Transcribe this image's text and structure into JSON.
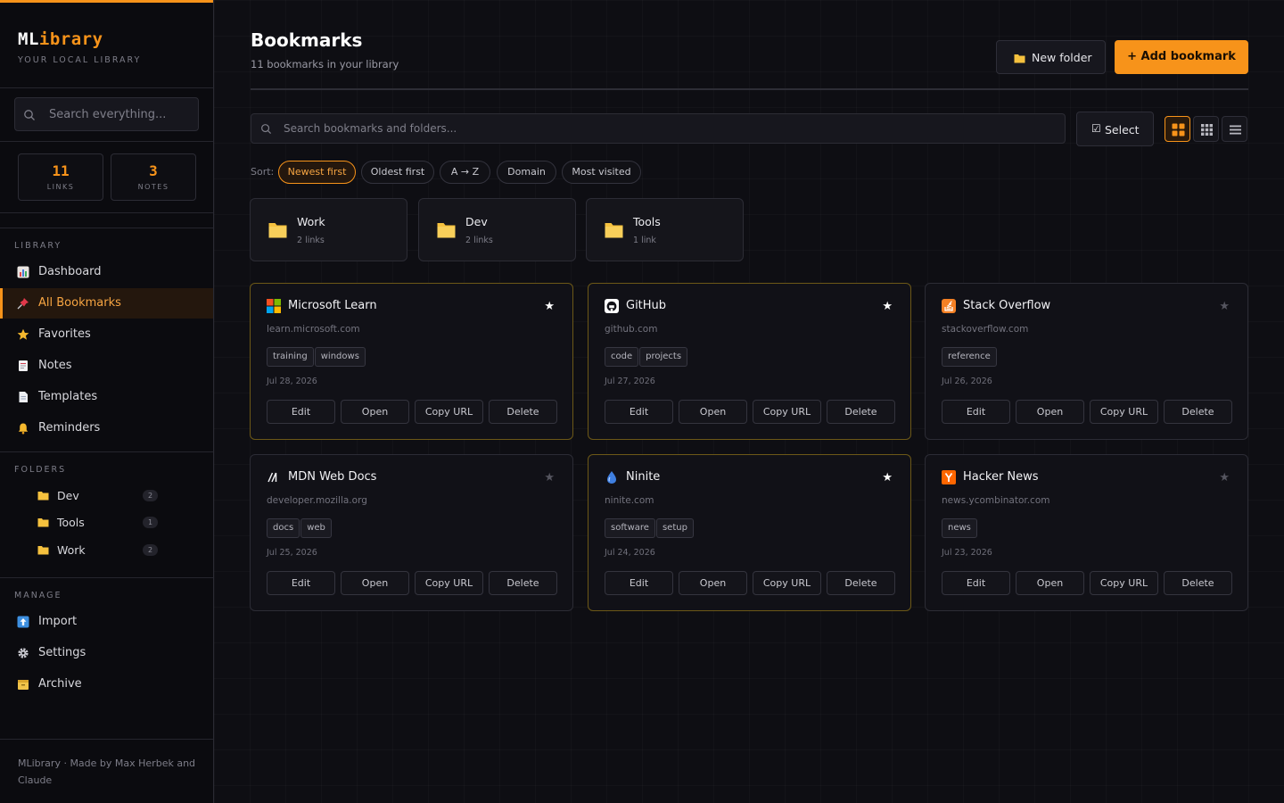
{
  "app": {
    "brand_part1": "ML",
    "brand_part2": "ibrary",
    "subtitle": "YOUR LOCAL LIBRARY",
    "accent": "#f7931a"
  },
  "sidebar": {
    "search_placeholder": "Search everything...",
    "stats": [
      {
        "value": "11",
        "label": "LINKS"
      },
      {
        "value": "3",
        "label": "NOTES"
      }
    ],
    "library_label": "LIBRARY",
    "library_items": [
      {
        "label": "Dashboard",
        "icon": "chart-icon",
        "active": false
      },
      {
        "label": "All Bookmarks",
        "icon": "pushpin-icon",
        "active": true
      },
      {
        "label": "Favorites",
        "icon": "star-icon",
        "active": false
      },
      {
        "label": "Notes",
        "icon": "note-icon",
        "active": false
      },
      {
        "label": "Templates",
        "icon": "document-icon",
        "active": false
      },
      {
        "label": "Reminders",
        "icon": "bell-icon",
        "active": false
      }
    ],
    "folders_label": "FOLDERS",
    "folders": [
      {
        "label": "Dev",
        "count": "2"
      },
      {
        "label": "Tools",
        "count": "1"
      },
      {
        "label": "Work",
        "count": "2"
      }
    ],
    "manage_label": "MANAGE",
    "manage_items": [
      {
        "label": "Import",
        "icon": "upload-icon"
      },
      {
        "label": "Settings",
        "icon": "gear-icon"
      },
      {
        "label": "Archive",
        "icon": "archive-icon"
      }
    ],
    "footer": "MLibrary · Made by Max Herbek and Claude"
  },
  "header": {
    "title": "Bookmarks",
    "subtitle": "11 bookmarks in your library",
    "new_folder_label": "New folder",
    "add_bookmark_label": "+ Add bookmark"
  },
  "toolbar": {
    "search_placeholder": "Search bookmarks and folders...",
    "select_check": "☑",
    "select_label": "Select",
    "view_modes": [
      "large-grid",
      "small-grid",
      "list"
    ],
    "active_view": "large-grid"
  },
  "sort": {
    "label": "Sort:",
    "options": [
      "Newest first",
      "Oldest first",
      "A → Z",
      "Domain",
      "Most visited"
    ],
    "active": "Newest first"
  },
  "folder_cards": [
    {
      "name": "Work",
      "count": "2 links"
    },
    {
      "name": "Dev",
      "count": "2 links"
    },
    {
      "name": "Tools",
      "count": "1 link"
    }
  ],
  "bookmarks": [
    {
      "title": "Microsoft Learn",
      "domain": "learn.microsoft.com",
      "tags": [
        "training",
        "windows"
      ],
      "date": "Jul 28, 2026",
      "favorite": true,
      "icon": "microsoft-icon"
    },
    {
      "title": "GitHub",
      "domain": "github.com",
      "tags": [
        "code",
        "projects"
      ],
      "date": "Jul 27, 2026",
      "favorite": true,
      "icon": "github-icon"
    },
    {
      "title": "Stack Overflow",
      "domain": "stackoverflow.com",
      "tags": [
        "reference"
      ],
      "date": "Jul 26, 2026",
      "favorite": false,
      "icon": "stackoverflow-icon"
    },
    {
      "title": "MDN Web Docs",
      "domain": "developer.mozilla.org",
      "tags": [
        "docs",
        "web"
      ],
      "date": "Jul 25, 2026",
      "favorite": false,
      "icon": "mdn-icon"
    },
    {
      "title": "Ninite",
      "domain": "ninite.com",
      "tags": [
        "software",
        "setup"
      ],
      "date": "Jul 24, 2026",
      "favorite": true,
      "icon": "ninite-icon"
    },
    {
      "title": "Hacker News",
      "domain": "news.ycombinator.com",
      "tags": [
        "news"
      ],
      "date": "Jul 23, 2026",
      "favorite": false,
      "icon": "hackernews-icon"
    }
  ],
  "card_actions": [
    "Edit",
    "Open",
    "Copy URL",
    "Delete"
  ],
  "star_glyph": "★"
}
